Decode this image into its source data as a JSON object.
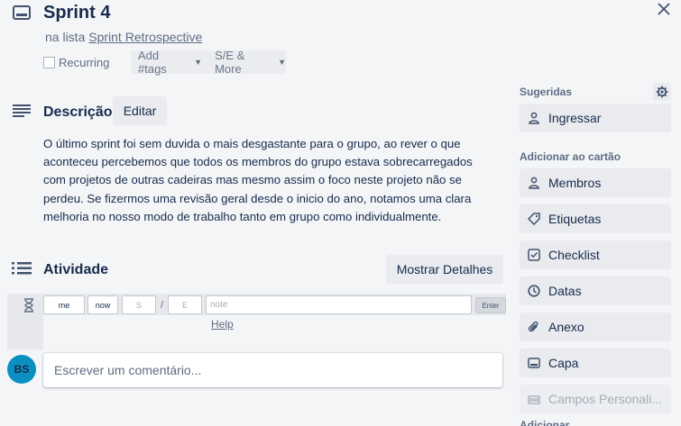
{
  "card": {
    "title": "Sprint 4",
    "in_list_prefix": "na lista",
    "list_name": "Sprint Retrospective"
  },
  "controls": {
    "recurring_label": "Recurring",
    "recurring_checked": false,
    "tags_label": "Add #tags",
    "se_label": "S/E & More"
  },
  "description": {
    "title": "Descrição",
    "edit_label": "Editar",
    "lines": [
      "O último sprint foi sem duvida o mais desgastante para o grupo, ao rever o que",
      "aconteceu percebemos que todos os membros do grupo estava sobrecarregados",
      "com projetos de outras cadeiras mas mesmo assim o foco neste projeto não se",
      "perdeu. Se fizermos uma revisão geral desde o inicio do ano, notamos uma clara",
      "melhoria no nosso modo de trabalho tanto em grupo como individualmente."
    ]
  },
  "activity": {
    "title": "Atividade",
    "details_label": "Mostrar Detalhes",
    "tracker": {
      "me": "me",
      "now": "now",
      "start_placeholder": "S",
      "separator": "/",
      "end_placeholder": "E",
      "note_placeholder": "note",
      "enter": "Enter",
      "help": "Help"
    },
    "avatar_initials": "BS",
    "comment_placeholder": "Escrever um comentário..."
  },
  "sidebar": {
    "suggested_heading": "Sugeridas",
    "join_label": "Ingressar",
    "add_heading": "Adicionar ao cartão",
    "items": [
      {
        "label": "Membros",
        "icon": "person-icon"
      },
      {
        "label": "Etiquetas",
        "icon": "tag-icon"
      },
      {
        "label": "Checklist",
        "icon": "checklist-icon"
      },
      {
        "label": "Datas",
        "icon": "clock-icon"
      },
      {
        "label": "Anexo",
        "icon": "paperclip-icon"
      },
      {
        "label": "Capa",
        "icon": "cover-icon"
      },
      {
        "label": "Campos Personali...",
        "icon": "custom-fields-icon",
        "disabled": true
      }
    ],
    "cut_off_heading": "Adicionar ...",
    "colors": {
      "accent_avatar": "#0a8fc1",
      "button_bg": "#e9ebee",
      "page_bg": "#f4f5f7"
    }
  }
}
